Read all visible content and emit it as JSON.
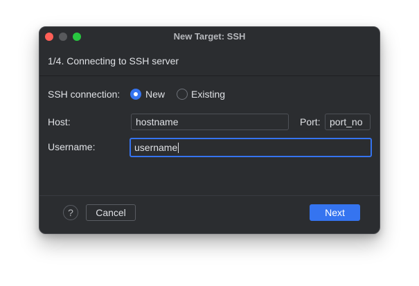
{
  "window": {
    "title": "New Target: SSH"
  },
  "step": {
    "title": "1/4. Connecting to SSH server"
  },
  "form": {
    "connection_label": "SSH connection:",
    "option_new": "New",
    "option_existing": "Existing",
    "selected_option": "New",
    "host_label": "Host:",
    "host_value": "hostname",
    "port_label": "Port:",
    "port_value": "port_no",
    "username_label": "Username:",
    "username_value": "username"
  },
  "footer": {
    "help_glyph": "?",
    "cancel_label": "Cancel",
    "next_label": "Next"
  },
  "colors": {
    "accent": "#3574f0",
    "window_bg": "#2b2d30",
    "close": "#ff5f57",
    "minimize": "#58595c",
    "maximize": "#28c840"
  },
  "icons": {
    "help": "question-mark-icon"
  }
}
